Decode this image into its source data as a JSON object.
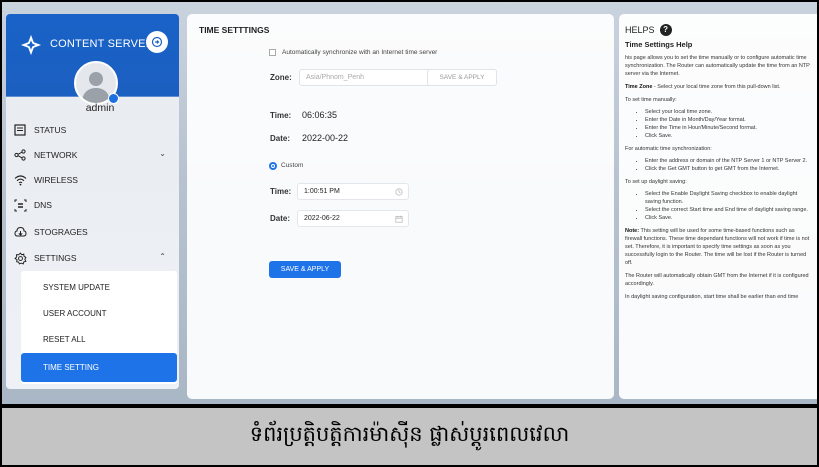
{
  "sidebar": {
    "brand": "CONTENT SERVER",
    "username": "admin",
    "items": [
      {
        "label": "STATUS",
        "icon": "status-icon"
      },
      {
        "label": "NETWORK",
        "icon": "share-icon"
      },
      {
        "label": "WIRELESS",
        "icon": "wifi-icon"
      },
      {
        "label": "DNS",
        "icon": "dns-icon"
      },
      {
        "label": "STOGRAGES",
        "icon": "storage-icon"
      },
      {
        "label": "SETTINGS",
        "icon": "gear-icon"
      }
    ],
    "submenu": [
      {
        "label": "SYSTEM UPDATE"
      },
      {
        "label": "USER ACCOUNT"
      },
      {
        "label": "RESET ALL"
      },
      {
        "label": "TIME SETTING",
        "active": true
      }
    ]
  },
  "main": {
    "title": "TIME SETTTINGS",
    "auto_sync_label": "Automatically synchronize with an Internet time server",
    "zone_label": "Zone:",
    "zone_value": "Asia/Phnom_Penh",
    "zone_apply": "SAVE & APPLY",
    "time_label": "Time:",
    "time_value": "06:06:35",
    "date_label": "Date:",
    "date_value": "2022-00-22",
    "custom_label": "Custom",
    "custom_time_label": "Time:",
    "custom_time_value": "1:00:51 PM",
    "custom_date_label": "Date:",
    "custom_date_value": "2022-06-22",
    "save_apply": "SAVE & APPLY"
  },
  "help": {
    "title": "HELPS",
    "subtitle": "Time Settings Help",
    "intro": "his page allows you to set the time manually or to configure automatic time synchronization. The Router can automatically update the time from an NTP server via the Internet.",
    "zone_bold": "Time Zone",
    "zone_text": " - Select your local time zone from this pull-down list.",
    "manual_heading": "To set time manually:",
    "manual_steps": [
      "Select your local time zone.",
      "Enter the Date in Month/Day/Year format.",
      "Enter the Time in Hour/Minute/Second format.",
      "Click Save."
    ],
    "auto_heading": "For automatic time synchronization:",
    "auto_steps": [
      "Enter the address or domain of the NTP Server 1 or NTP Server 2.",
      "Click the Get GMT button to get GMT from the Internet."
    ],
    "dst_heading": "To set up daylight saving:",
    "dst_steps": [
      "Select the Enable Daylight Saving checkbox to enable daylight saving function.",
      "Select the correct Start time and End time of daylight saving range.",
      "Click Save."
    ],
    "note_bold": "Note:",
    "note_text": " This setting will be used for some time-based functions such as firewall functions. These time dependant functions will not work if time is not set. Therefore, it is important to specify time settings as soon as you successfully login to the Router. The time will be lost if the Router is turned off.",
    "gmt_text": "The Router will automatically obtain GMT from the Internet if it is configured accordingly.",
    "dst_text": "In daylight saving configuration, start time shall be earlier than end time"
  },
  "caption": "ទំព័រប្រត្តិបត្តិការម៉ាស៊ីន ផ្លាស់ប្ដូរពេលវេលា"
}
